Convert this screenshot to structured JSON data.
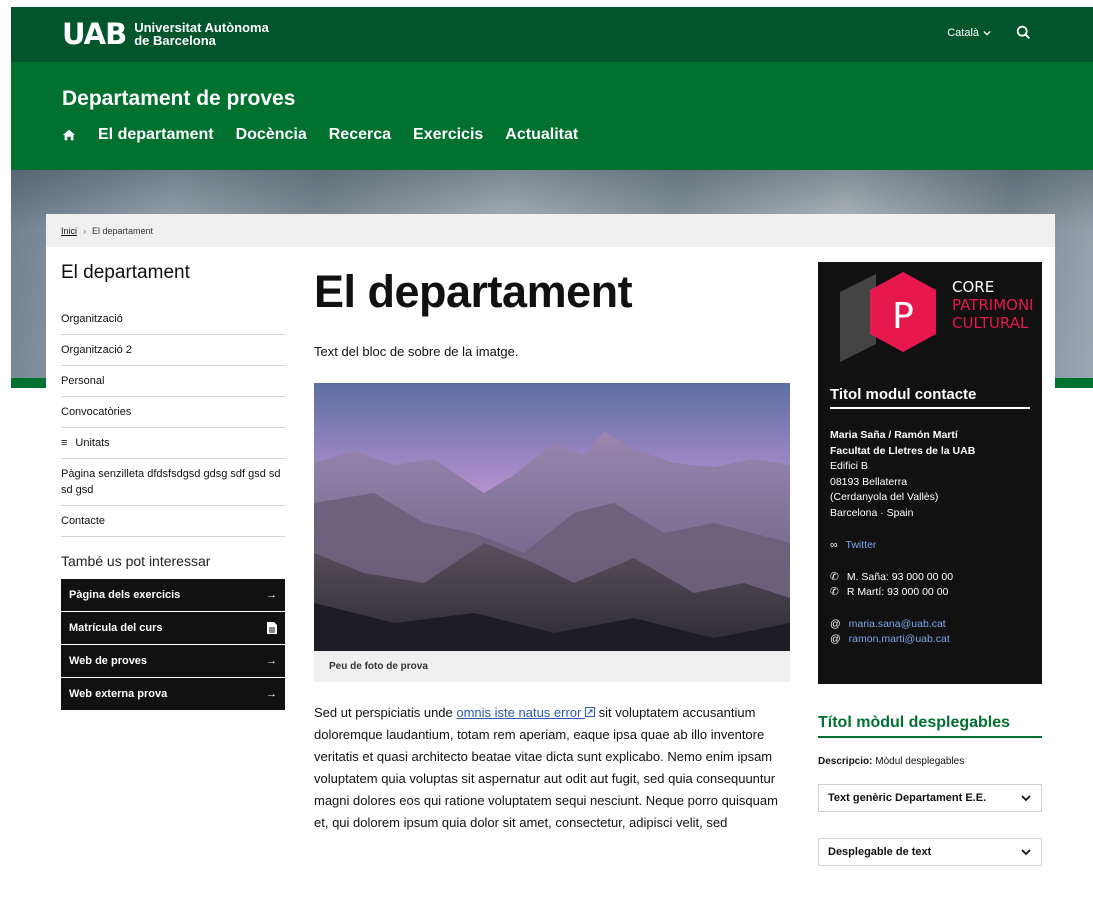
{
  "header": {
    "logo_mark": "UAB",
    "logo_line1": "Universitat Autònoma",
    "logo_line2": "de Barcelona",
    "language": "Català",
    "department_title": "Departament de proves",
    "nav": [
      "El departament",
      "Docència",
      "Recerca",
      "Exercicis",
      "Actualitat"
    ]
  },
  "breadcrumb": {
    "home": "Inici",
    "separator": "›",
    "current": "El departament"
  },
  "sidebar": {
    "title": "El departament",
    "items": [
      "Organització",
      "Organització 2",
      "Personal",
      "Convocatòries",
      "Unitats",
      "Pàgina senzilleta dfdsfsdgsd gdsg sdf gsd sd sd gsd",
      "Contacte"
    ],
    "also_title": "També us pot interessar",
    "links": [
      {
        "label": "Pàgina dels exercicis",
        "icon": "arrow-right-icon"
      },
      {
        "label": "Matrícula del curs",
        "icon": "document-icon"
      },
      {
        "label": "Web de proves",
        "icon": "arrow-right-icon"
      },
      {
        "label": "Web externa prova",
        "icon": "arrow-right-icon"
      }
    ]
  },
  "main": {
    "title": "El departament",
    "intro": "Text del bloc de sobre de la imatge.",
    "caption": "Peu de foto de prova",
    "body_before_link": "Sed ut perspiciatis unde ",
    "body_link": "omnis iste natus error",
    "body_after_link": " sit voluptatem accusantium doloremque laudantium, totam rem aperiam, eaque ipsa quae ab illo inventore veritatis et quasi architecto beatae vitae dicta sunt explicabo. Nemo enim ipsam voluptatem quia voluptas sit aspernatur aut odit aut fugit, sed quia consequuntur magni dolores eos qui ratione voluptatem sequi nesciunt. Neque porro quisquam et, qui dolorem ipsum quia dolor sit amet, consectetur, adipisci velit, sed"
  },
  "contact": {
    "logo_line1": "CORE",
    "logo_line2": "PATRIMONI",
    "logo_line3": "CULTURAL",
    "logo_letter": "P",
    "title": "Titol modul contacte",
    "names": "Maria Saña / Ramón Martí",
    "faculty": "Facultat de Lletres de la UAB",
    "building": "Edifici B",
    "postal": "08193 Bellaterra",
    "city": "(Cerdanyola del Vallès)",
    "country": "Barcelona · Spain",
    "twitter": "Twitter",
    "phone1": "M. Saña: 93 000 00 00",
    "phone2": "R Martí: 93 000 00 00",
    "email1": "maria.sana@uab.cat",
    "email2": "ramon.marti@uab.cat"
  },
  "desplegables": {
    "title": "Títol mòdul desplegables",
    "desc_label": "Descripcio:",
    "desc_value": " Mòdul desplegables",
    "items": [
      "Text genèric Departament E.E.",
      "Desplegable de text"
    ]
  },
  "colors": {
    "dark_green": "#00552a",
    "green": "#00712f",
    "core_pink": "#e7184d",
    "link_blue": "#2b57b5"
  }
}
